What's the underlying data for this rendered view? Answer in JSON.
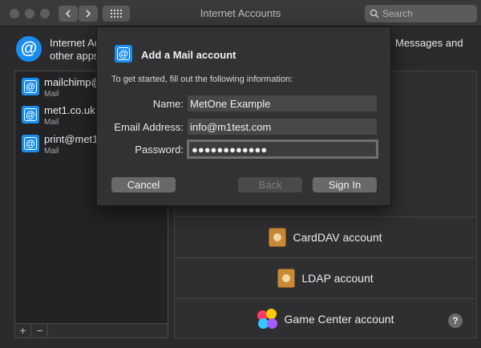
{
  "window": {
    "title": "Internet Accounts",
    "search_placeholder": "Search"
  },
  "header": {
    "description_partial": "Internet Ac other apps",
    "description_line1": "Internet Ac",
    "description_line2": "other apps",
    "description_right": "Messages and"
  },
  "accounts": [
    {
      "name": "mailchimp@",
      "type": "Mail"
    },
    {
      "name": "met1.co.uk",
      "type": "Mail"
    },
    {
      "name": "print@met1.",
      "type": "Mail"
    }
  ],
  "list_controls": {
    "add": "+",
    "remove": "−"
  },
  "providers": [
    {
      "label": "CardDAV account",
      "icon": "address-book-icon"
    },
    {
      "label": "LDAP account",
      "icon": "address-book-icon"
    },
    {
      "label": "Game Center account",
      "icon": "game-center-icon"
    }
  ],
  "help": "?",
  "sheet": {
    "title": "Add a Mail account",
    "instructions": "To get started, fill out the following information:",
    "name_label": "Name:",
    "name_value": "MetOne Example",
    "email_label": "Email Address:",
    "email_value": "info@m1test.com",
    "password_label": "Password:",
    "password_value": "●●●●●●●●●●●●",
    "cancel_label": "Cancel",
    "back_label": "Back",
    "signin_label": "Sign In"
  },
  "colors": {
    "accent": "#1a8df0",
    "window_bg": "#2b2b2d",
    "sheet_bg": "#323234"
  }
}
